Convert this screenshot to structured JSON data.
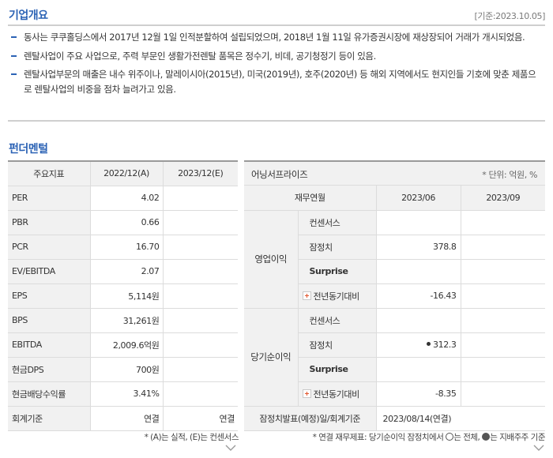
{
  "overview": {
    "title": "기업개요",
    "date_stamp": "[기준:2023.10.05]",
    "bullets": [
      "동사는 쿠쿠홀딩스에서 2017년 12월 1일 인적분할하여 설립되었으며, 2018년 1월 11일 유가증권시장에 재상장되어 거래가 개시되었음.",
      "렌탈사업이 주요 사업으로, 주력 부문인 생활가전렌탈 품목은 정수기, 비데, 공기청정기 등이 있음.",
      "렌탈사업부문의 매출은 내수 위주이나, 말레이시아(2015년), 미국(2019년), 호주(2020년) 등 해외 지역에서도 현지인들 기호에 맞춘 제품으로 렌탈사업의 비중을 점차 늘려가고 있음."
    ]
  },
  "fundamentals": {
    "title": "펀더멘털",
    "headers": [
      "주요지표",
      "2022/12(A)",
      "2023/12(E)"
    ],
    "rows": [
      {
        "label": "PER",
        "a": "4.02",
        "e": ""
      },
      {
        "label": "PBR",
        "a": "0.66",
        "e": ""
      },
      {
        "label": "PCR",
        "a": "16.70",
        "e": ""
      },
      {
        "label": "EV/EBITDA",
        "a": "2.07",
        "e": ""
      },
      {
        "label": "EPS",
        "a": "5,114원",
        "e": ""
      },
      {
        "label": "BPS",
        "a": "31,261원",
        "e": ""
      },
      {
        "label": "EBITDA",
        "a": "2,009.6억원",
        "e": ""
      },
      {
        "label": "현금DPS",
        "a": "700원",
        "e": ""
      },
      {
        "label": "현금배당수익률",
        "a": "3.41%",
        "e": ""
      },
      {
        "label": "회계기준",
        "a": "연결",
        "e": "연결"
      }
    ],
    "note": "* (A)는 실적, (E)는 컨센서스"
  },
  "earnings": {
    "title": "어닝서프라이즈",
    "unit": "* 단위: 억원, %",
    "headers": [
      "재무연월",
      "2023/06",
      "2023/09"
    ],
    "groups": [
      {
        "name": "영업이익",
        "rows": [
          {
            "label": "컨센서스",
            "v1": "",
            "v2": ""
          },
          {
            "label": "잠정치",
            "v1": "378.8",
            "v2": ""
          },
          {
            "label": "Surprise",
            "v1": "",
            "v2": ""
          },
          {
            "label": "전년동기대비",
            "v1": "-16.43",
            "v2": ""
          }
        ]
      },
      {
        "name": "당기순이익",
        "rows": [
          {
            "label": "컨센서스",
            "v1": "",
            "v2": ""
          },
          {
            "label": "잠정치",
            "v1": "312.3",
            "v2": ""
          },
          {
            "label": "Surprise",
            "v1": "",
            "v2": ""
          },
          {
            "label": "전년동기대비",
            "v1": "-8.35",
            "v2": ""
          }
        ]
      }
    ],
    "footer_label": "잠정치발표(예정)일/회계기준",
    "footer_value": "2023/08/14(연결)",
    "note_parts": [
      "* 연결 재무제표: 당기순이익 잠정치에서 ",
      "는 전체, ",
      "는 지배주주 기준"
    ]
  }
}
